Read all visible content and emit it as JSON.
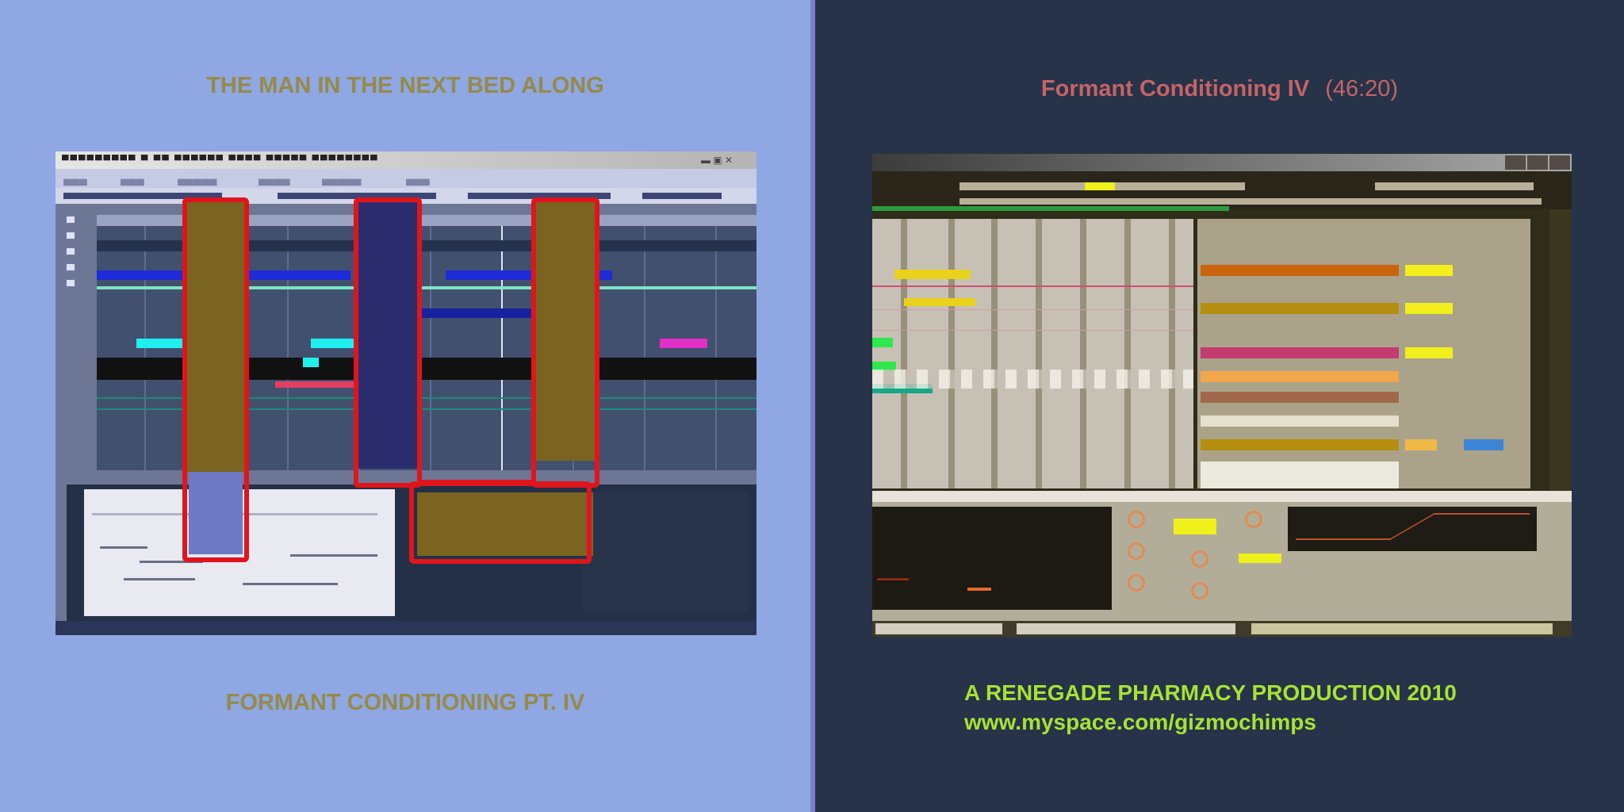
{
  "left": {
    "top_title": "THE MAN IN THE NEXT BED ALONG",
    "bottom_title": "FORMANT CONDITIONING PT. IV"
  },
  "right": {
    "top_title": "Formant Conditioning IV",
    "duration": "(46:20)",
    "credit_line1": "A RENEGADE PHARMACY PRODUCTION 2010",
    "credit_line2": "www.myspace.com/gizmochimps"
  },
  "colors": {
    "left_background": "#8fa7e2",
    "right_background": "#273348",
    "left_title_color": "#958a49",
    "right_title_color": "#c46468",
    "credit_color": "#a7e234",
    "highlight_box_color": "#e0151c"
  }
}
